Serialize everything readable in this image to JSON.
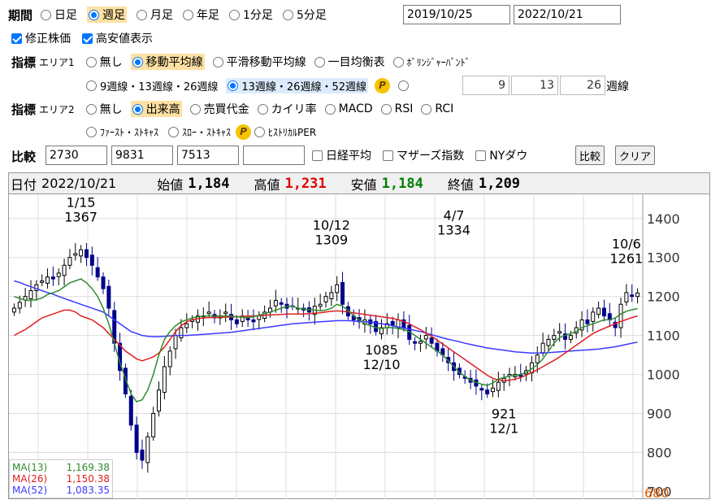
{
  "period": {
    "label": "期間",
    "options": [
      {
        "label": "日足",
        "selected": false
      },
      {
        "label": "週足",
        "selected": true
      },
      {
        "label": "月足",
        "selected": false
      },
      {
        "label": "年足",
        "selected": false
      },
      {
        "label": "1分足",
        "selected": false
      },
      {
        "label": "5分足",
        "selected": false
      }
    ],
    "from": "2019/10/25",
    "to": "2022/10/21"
  },
  "options": {
    "adjusted": {
      "label": "修正株価",
      "checked": true
    },
    "high_low": {
      "label": "高安値表示",
      "checked": true
    }
  },
  "indicator1": {
    "label": "指標",
    "area": "エリア1",
    "options": [
      "無し",
      "移動平均線",
      "平滑移動平均線",
      "一目均衡表",
      "ﾎﾞﾘﾝｼﾞｬｰﾊﾞﾝﾄﾞ"
    ],
    "selected": "移動平均線",
    "ma_sets": [
      "9週線・13週線・26週線",
      "13週線・26週線・52週線"
    ],
    "ma_selected": "13週線・26週線・52週線",
    "custom_values": [
      "9",
      "13",
      "26"
    ],
    "custom_unit": "週線",
    "p_badge": "P"
  },
  "indicator2": {
    "label": "指標",
    "area": "エリア2",
    "options": [
      "無し",
      "出来高",
      "売買代金",
      "カイリ率",
      "MACD",
      "RSI",
      "RCI"
    ],
    "selected": "出来高",
    "options2": [
      "ﾌｧｰｽﾄ・ｽﾄｷｬｽ",
      "ｽﾛｰ・ｽﾄｷｬｽ",
      "ﾋｽﾄﾘｶﾙPER"
    ],
    "p_badge": "P"
  },
  "compare": {
    "label": "比較",
    "codes": [
      "2730",
      "9831",
      "7513",
      ""
    ],
    "checks": [
      "日経平均",
      "マザーズ指数",
      "NYダウ"
    ],
    "compare_button": "比較",
    "clear_button": "クリア"
  },
  "info": {
    "date_label": "日付",
    "date": "2022/10/21",
    "open_label": "始値",
    "open": "1,184",
    "high_label": "高値",
    "high": "1,231",
    "low_label": "安値",
    "low": "1,184",
    "close_label": "終値",
    "close": "1,209"
  },
  "legend": {
    "ma13": {
      "label": "MA(13)",
      "value": "1,169.38"
    },
    "ma26": {
      "label": "MA(26)",
      "value": "1,150.38"
    },
    "ma52": {
      "label": "MA(52)",
      "value": "1,083.35"
    }
  },
  "colors": {
    "up": "#000000",
    "down": "#00008b",
    "ma13": "#2e8b2e",
    "ma26": "#e02020",
    "ma52": "#3a3aff",
    "high_value": "#e00000",
    "low_value": "#008000"
  },
  "chart_data": {
    "type": "candlestick",
    "y_ticks": [
      1400,
      1300,
      1200,
      1100,
      1000,
      900,
      800,
      700
    ],
    "y_ticks_extra": [
      "680"
    ],
    "ylim": [
      680,
      1460
    ],
    "annotations": [
      {
        "date": "1/15",
        "value": "1367",
        "pos": "above"
      },
      {
        "date": "10/12",
        "value": "1309",
        "pos": "above"
      },
      {
        "date": "4/7",
        "value": "1334",
        "pos": "above"
      },
      {
        "date": "10/6",
        "value": "1261",
        "pos": "above"
      },
      {
        "date": "12/10",
        "value": "1085",
        "pos": "below"
      },
      {
        "date": "12/1",
        "value": "921",
        "pos": "below"
      }
    ],
    "close": [
      1170,
      1185,
      1200,
      1215,
      1230,
      1240,
      1250,
      1245,
      1260,
      1280,
      1300,
      1310,
      1320,
      1300,
      1280,
      1250,
      1220,
      1170,
      1080,
      1010,
      950,
      870,
      800,
      780,
      840,
      900,
      960,
      1020,
      1060,
      1100,
      1120,
      1130,
      1140,
      1150,
      1150,
      1160,
      1145,
      1150,
      1160,
      1140,
      1130,
      1150,
      1140,
      1135,
      1150,
      1160,
      1170,
      1190,
      1180,
      1170,
      1175,
      1170,
      1165,
      1160,
      1175,
      1180,
      1200,
      1210,
      1230,
      1180,
      1150,
      1140,
      1135,
      1140,
      1130,
      1110,
      1120,
      1130,
      1125,
      1140,
      1120,
      1090,
      1080,
      1085,
      1100,
      1080,
      1060,
      1050,
      1030,
      1010,
      1000,
      990,
      980,
      970,
      960,
      950,
      965,
      980,
      990,
      1000,
      1000,
      995,
      1010,
      1030,
      1050,
      1080,
      1090,
      1100,
      1110,
      1090,
      1100,
      1120,
      1140,
      1130,
      1160,
      1170,
      1150,
      1140,
      1120,
      1180,
      1210,
      1200,
      1209
    ],
    "ma13": [
      1200,
      1195,
      1190,
      1190,
      1192,
      1196,
      1205,
      1210,
      1215,
      1225,
      1235,
      1240,
      1245,
      1235,
      1220,
      1200,
      1170,
      1130,
      1080,
      1030,
      990,
      950,
      930,
      935,
      960,
      1000,
      1050,
      1090,
      1110,
      1125,
      1135,
      1140,
      1145,
      1148,
      1150,
      1150,
      1150,
      1150,
      1150,
      1150,
      1148,
      1147,
      1146,
      1148,
      1152,
      1156,
      1160,
      1165,
      1170,
      1175,
      1175,
      1170,
      1168,
      1166,
      1165,
      1163,
      1165,
      1170,
      1180,
      1175,
      1165,
      1150,
      1140,
      1130,
      1125,
      1120,
      1118,
      1120,
      1120,
      1118,
      1115,
      1110,
      1100,
      1090,
      1080,
      1070,
      1060,
      1050,
      1035,
      1020,
      1005,
      995,
      985,
      980,
      975,
      972,
      978,
      988,
      992,
      996,
      998,
      1000,
      1005,
      1015,
      1025,
      1040,
      1060,
      1080,
      1095,
      1100,
      1105,
      1110,
      1120,
      1125,
      1130,
      1135,
      1140,
      1140,
      1145,
      1155,
      1162,
      1166,
      1169
    ],
    "ma26": [
      1100,
      1108,
      1115,
      1125,
      1135,
      1145,
      1150,
      1155,
      1160,
      1165,
      1165,
      1160,
      1150,
      1145,
      1140,
      1130,
      1120,
      1105,
      1090,
      1075,
      1060,
      1050,
      1040,
      1035,
      1040,
      1045,
      1055,
      1070,
      1090,
      1110,
      1125,
      1135,
      1140,
      1143,
      1145,
      1146,
      1146,
      1147,
      1147,
      1148,
      1148,
      1149,
      1150,
      1150,
      1151,
      1152,
      1153,
      1153,
      1154,
      1155,
      1155,
      1155,
      1155,
      1156,
      1157,
      1158,
      1160,
      1162,
      1163,
      1162,
      1160,
      1158,
      1156,
      1154,
      1152,
      1150,
      1148,
      1146,
      1144,
      1140,
      1136,
      1130,
      1122,
      1115,
      1106,
      1098,
      1088,
      1078,
      1068,
      1058,
      1048,
      1038,
      1028,
      1018,
      1008,
      998,
      990,
      986,
      984,
      985,
      988,
      992,
      998,
      1005,
      1012,
      1020,
      1028,
      1036,
      1045,
      1055,
      1065,
      1075,
      1085,
      1095,
      1105,
      1112,
      1118,
      1124,
      1130,
      1136,
      1141,
      1146,
      1150
    ],
    "ma52": [
      1240,
      1236,
      1230,
      1225,
      1220,
      1215,
      1210,
      1206,
      1200,
      1195,
      1190,
      1185,
      1180,
      1175,
      1170,
      1165,
      1160,
      1150,
      1140,
      1130,
      1120,
      1110,
      1105,
      1100,
      1098,
      1097,
      1097,
      1098,
      1099,
      1100,
      1100,
      1100,
      1101,
      1102,
      1103,
      1104,
      1105,
      1106,
      1107,
      1108,
      1110,
      1112,
      1114,
      1116,
      1118,
      1120,
      1122,
      1124,
      1126,
      1128,
      1130,
      1131,
      1132,
      1133,
      1134,
      1135,
      1136,
      1137,
      1138,
      1138,
      1138,
      1137,
      1136,
      1135,
      1134,
      1132,
      1130,
      1128,
      1125,
      1122,
      1119,
      1116,
      1113,
      1110,
      1106,
      1102,
      1098,
      1094,
      1090,
      1087,
      1084,
      1080,
      1077,
      1074,
      1071,
      1068,
      1066,
      1064,
      1062,
      1060,
      1058,
      1057,
      1056,
      1055,
      1055,
      1055,
      1056,
      1057,
      1058,
      1059,
      1060,
      1061,
      1062,
      1063,
      1064,
      1065,
      1067,
      1069,
      1071,
      1074,
      1077,
      1080,
      1083
    ]
  }
}
